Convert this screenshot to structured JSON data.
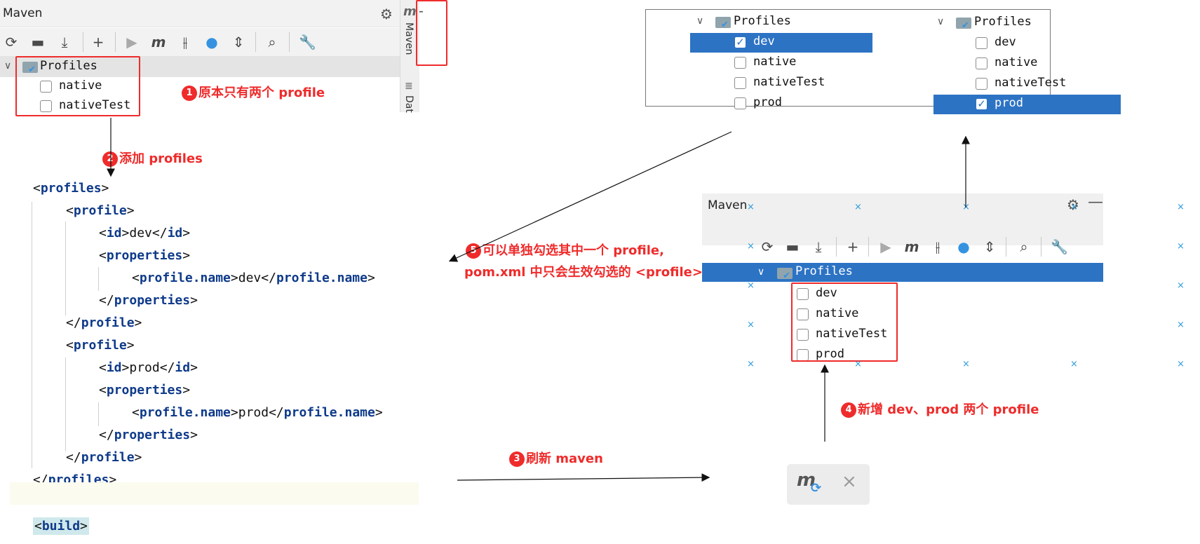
{
  "top_panel": {
    "title": "Maven",
    "side_tabs": [
      "Maven",
      "Dat"
    ],
    "tree_root": "Profiles",
    "profiles": [
      {
        "label": "native",
        "checked": false
      },
      {
        "label": "nativeTest",
        "checked": false
      }
    ]
  },
  "annotations": {
    "a1": {
      "num": "1",
      "text": "原本只有两个 profile"
    },
    "a2": {
      "num": "2",
      "text": "添加 profiles"
    },
    "a3": {
      "num": "3",
      "text": "刷新 maven"
    },
    "a4": {
      "num": "4",
      "text": "新增 dev、prod 两个 profile"
    },
    "a5": {
      "num": "5",
      "line1": "可以单独勾选其中一个 profile,",
      "line2": "pom.xml 中只会生效勾选的 <profile>"
    }
  },
  "code": {
    "profiles_tag": "profiles",
    "profile_tag": "profile",
    "id_tag": "id",
    "properties_tag": "properties",
    "name_tag": "profile.name",
    "dev_value": "dev",
    "prod_value": "prod",
    "build_tag": "build"
  },
  "popup": {
    "left": {
      "root": "Profiles",
      "items": [
        {
          "label": "dev",
          "checked": true,
          "selected": true
        },
        {
          "label": "native",
          "checked": false
        },
        {
          "label": "nativeTest",
          "checked": false
        },
        {
          "label": "prod",
          "checked": false
        }
      ]
    },
    "right": {
      "root": "Profiles",
      "items": [
        {
          "label": "dev",
          "checked": false
        },
        {
          "label": "native",
          "checked": false
        },
        {
          "label": "nativeTest",
          "checked": false
        },
        {
          "label": "prod",
          "checked": true,
          "selected": true
        }
      ]
    }
  },
  "bottom_panel": {
    "title": "Maven",
    "tree_root": "Profiles",
    "profiles": [
      {
        "label": "dev",
        "checked": false
      },
      {
        "label": "native",
        "checked": false
      },
      {
        "label": "nativeTest",
        "checked": false
      },
      {
        "label": "prod",
        "checked": false
      }
    ]
  },
  "colors": {
    "annotation_red": "#ef2b2b",
    "selection_blue": "#2d73c4",
    "xml_tag_blue": "#0e3a8a"
  },
  "icons": [
    "refresh-icon",
    "add-folder-icon",
    "download-icon",
    "plus-icon",
    "run-icon",
    "maven-m-icon",
    "skip-tests-icon",
    "lightning-icon",
    "collapse-icon",
    "analyze-icon",
    "settings-wrench-icon",
    "gear-icon",
    "minimize-icon",
    "database-icon",
    "close-icon",
    "maven-refresh-icon"
  ]
}
